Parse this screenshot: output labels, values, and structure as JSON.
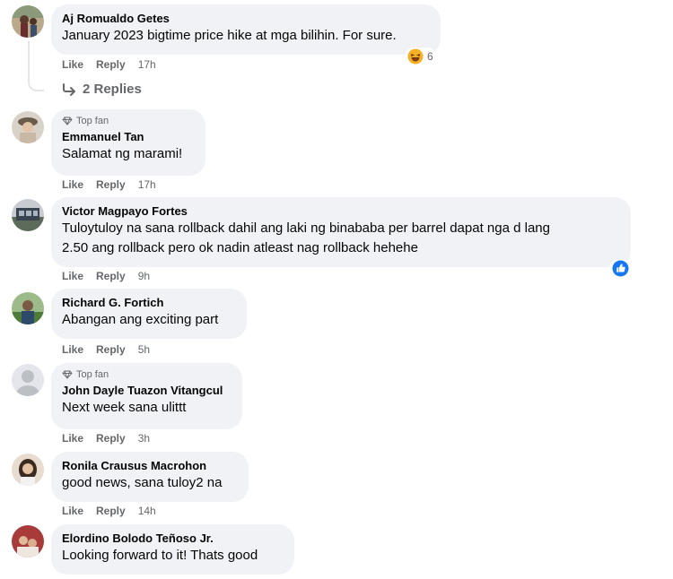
{
  "comments": [
    {
      "author": "Aj Romualdo Getes",
      "badge": "",
      "text": "January 2023 bigtime price hike at mga bilihin. For sure.",
      "like": "Like",
      "reply": "Reply",
      "time": "17h",
      "reaction_count": "6"
    },
    {
      "author": "Emmanuel Tan",
      "badge": "Top fan",
      "text": "Salamat ng marami!",
      "like": "Like",
      "reply": "Reply",
      "time": "17h"
    },
    {
      "author": "Victor Magpayo Fortes",
      "badge": "",
      "text_line1": "Tuloytuloy na sana rollback dahil ang laki ng binababa per barrel dapat nga d lang",
      "text_line2": "2.50 ang rollback pero ok nadin atleast nag rollback hehehe",
      "like": "Like",
      "reply": "Reply",
      "time": "9h"
    },
    {
      "author": "Richard G. Fortich",
      "badge": "",
      "text": "Abangan ang exciting part",
      "like": "Like",
      "reply": "Reply",
      "time": "5h"
    },
    {
      "author": "John Dayle Tuazon Vitangcul",
      "badge": "Top fan",
      "text": "Next week sana ulittt",
      "like": "Like",
      "reply": "Reply",
      "time": "3h"
    },
    {
      "author": "Ronila Crausus Macrohon",
      "badge": "",
      "text": "good news, sana tuloy2 na",
      "like": "Like",
      "reply": "Reply",
      "time": "14h"
    },
    {
      "author": "Elordino Bolodo Teñoso Jr.",
      "badge": "",
      "text": "Looking forward to it! Thats good"
    }
  ],
  "replies_label": "2 Replies",
  "colors": {
    "bubble": "#f0f2f5",
    "secondary": "#65676b",
    "like_blue": "#1877f2"
  }
}
